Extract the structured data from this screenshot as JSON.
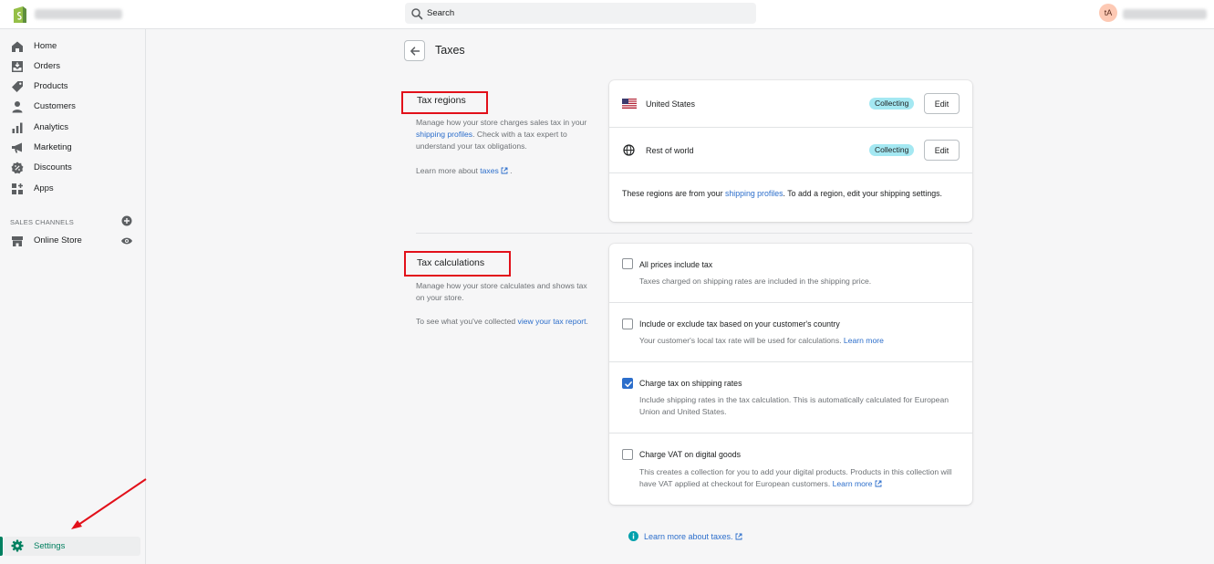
{
  "topbar": {
    "search_placeholder": "Search",
    "avatar_initials": "tA"
  },
  "sidebar": {
    "items": [
      {
        "label": "Home",
        "icon": "home-icon"
      },
      {
        "label": "Orders",
        "icon": "orders-icon"
      },
      {
        "label": "Products",
        "icon": "tag-icon"
      },
      {
        "label": "Customers",
        "icon": "person-icon"
      },
      {
        "label": "Analytics",
        "icon": "bar-chart-icon"
      },
      {
        "label": "Marketing",
        "icon": "megaphone-icon"
      },
      {
        "label": "Discounts",
        "icon": "discount-icon"
      },
      {
        "label": "Apps",
        "icon": "apps-icon"
      }
    ],
    "sales_channels_heading": "SALES CHANNELS",
    "online_store_label": "Online Store",
    "settings_label": "Settings",
    "accent_color": "#008060"
  },
  "page": {
    "title": "Taxes"
  },
  "tax_regions": {
    "title": "Tax regions",
    "desc_1": "Manage how your store charges sales tax in your",
    "desc_link": "shipping profiles",
    "desc_2": ". Check with a tax expert to understand your tax obligations.",
    "learn_prefix": "Learn more about",
    "learn_link": "taxes",
    "learn_suffix": ".",
    "regions": [
      {
        "name": "United States",
        "status": "Collecting",
        "edit": "Edit"
      },
      {
        "name": "Rest of world",
        "status": "Collecting",
        "edit": "Edit"
      }
    ],
    "footer_1": "These regions are from your",
    "footer_link": "shipping profiles",
    "footer_2": ". To add a region, edit your shipping settings."
  },
  "tax_calculations": {
    "title": "Tax calculations",
    "desc": "Manage how your store calculates and shows tax on your store.",
    "report_prefix": "To see what you've collected",
    "report_link": "view your tax report",
    "report_suffix": ".",
    "options": [
      {
        "label": "All prices include tax",
        "help": "Taxes charged on shipping rates are included in the shipping price.",
        "checked": false
      },
      {
        "label": "Include or exclude tax based on your customer's country",
        "help": "Your customer's local tax rate will be used for calculations.",
        "help_link": "Learn more",
        "checked": false
      },
      {
        "label": "Charge tax on shipping rates",
        "help": "Include shipping rates in the tax calculation. This is automatically calculated for European Union and United States.",
        "checked": true
      },
      {
        "label": "Charge VAT on digital goods",
        "help": "This creates a collection for you to add your digital products. Products in this collection will have VAT applied at checkout for European customers.",
        "help_link": "Learn more",
        "checked": false
      }
    ]
  },
  "footer": {
    "learn_more": "Learn more about taxes."
  },
  "colors": {
    "badge": "#a4e8f2",
    "link": "#2c6ecb",
    "annotation": "#e2101a"
  }
}
